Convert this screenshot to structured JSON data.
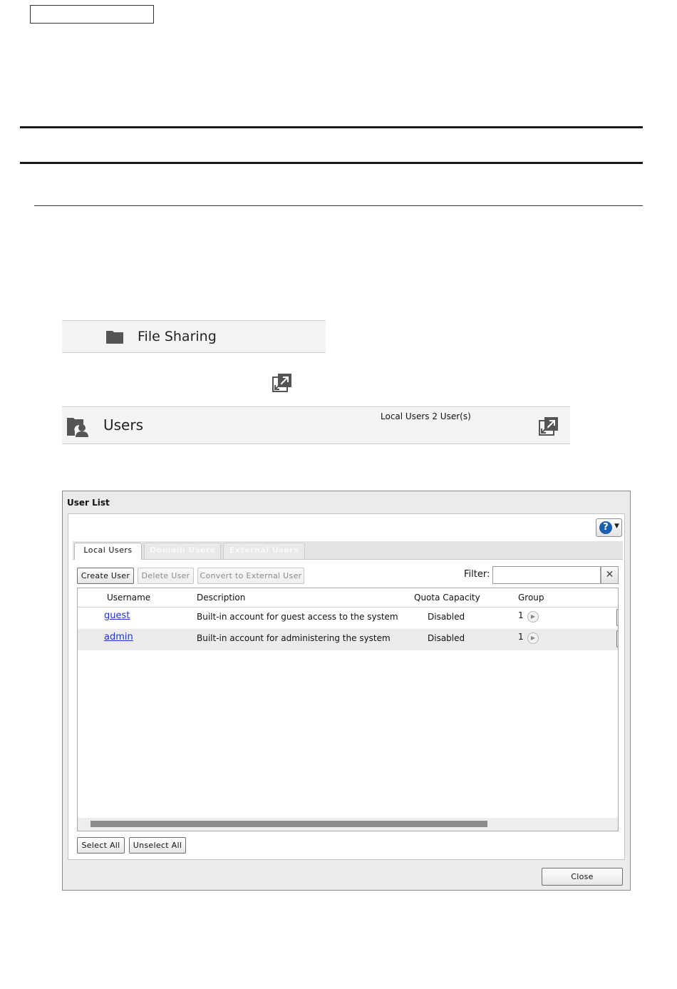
{
  "file_sharing": {
    "label": "File Sharing"
  },
  "users_panel": {
    "label": "Users",
    "summary": "Local Users 2 User(s)"
  },
  "dialog": {
    "title": "User List",
    "tabs": [
      {
        "label": "Local Users",
        "active": true
      },
      {
        "label": "Domain Users",
        "active": false
      },
      {
        "label": "External Users",
        "active": false
      }
    ],
    "toolbar": {
      "create_label": "Create User",
      "delete_label": "Delete User",
      "convert_label": "Convert to External User",
      "filter_label": "Filter:",
      "filter_value": ""
    },
    "columns": [
      "Username",
      "Description",
      "Quota Capacity",
      "Group"
    ],
    "rows": [
      {
        "username": "guest",
        "description": "Built-in account for guest access to the system",
        "quota": "Disabled",
        "group": "1"
      },
      {
        "username": "admin",
        "description": "Built-in account for administering the system",
        "quota": "Disabled",
        "group": "1"
      }
    ],
    "select_all_label": "Select All",
    "unselect_all_label": "Unselect All",
    "close_label": "Close"
  },
  "icons": {
    "help": "help-icon",
    "folder": "folder-icon",
    "users": "users-folder-icon",
    "expand": "expand-icon",
    "clear": "close-icon",
    "row_arrow": "play-arrow-icon"
  },
  "colors": {
    "link": "#1a33cc",
    "help_blue": "#1b5fb1"
  }
}
